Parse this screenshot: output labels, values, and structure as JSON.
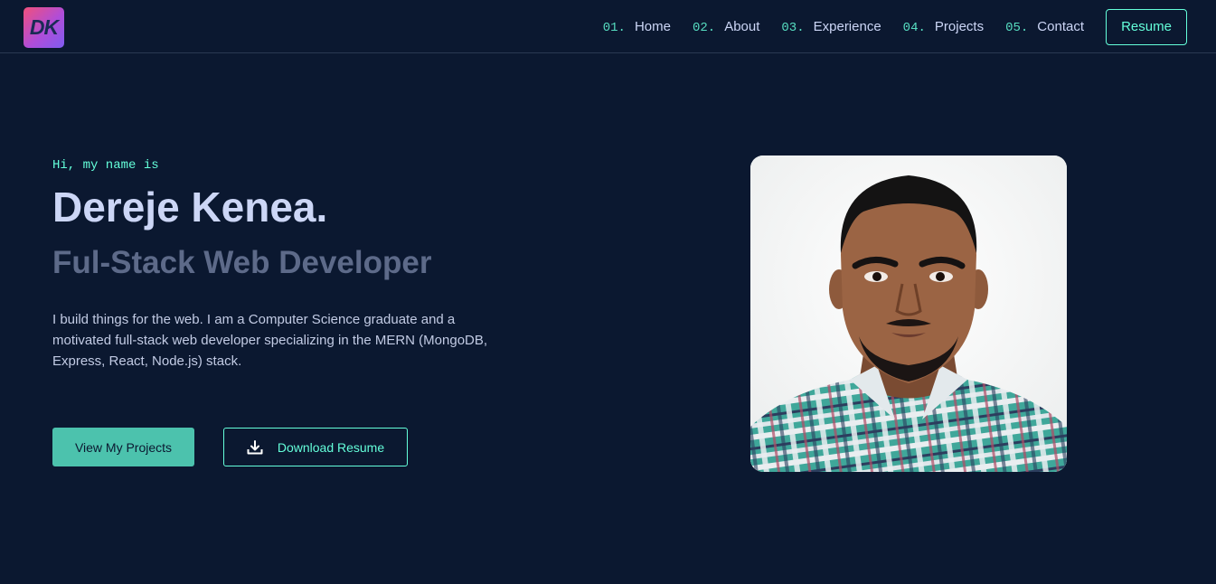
{
  "logo": {
    "text": "DK"
  },
  "nav": {
    "items": [
      {
        "num": "01.",
        "label": "Home"
      },
      {
        "num": "02.",
        "label": "About"
      },
      {
        "num": "03.",
        "label": "Experience"
      },
      {
        "num": "04.",
        "label": "Projects"
      },
      {
        "num": "05.",
        "label": "Contact"
      }
    ],
    "resume_label": "Resume"
  },
  "hero": {
    "greeting": "Hi, my name is",
    "name": "Dereje Kenea.",
    "role": "Ful-Stack Web Developer",
    "bio": "I build things for the web. I am a Computer Science graduate and a motivated full-stack web developer specializing in the MERN (MongoDB, Express, React, Node.js) stack.",
    "primary_button": "View My Projects",
    "secondary_button": "Download Resume",
    "secondary_icon": "download-icon",
    "photo_icon": "profile-photo"
  },
  "colors": {
    "background": "#0b1830",
    "accent": "#64ffda",
    "primary_button": "#4cc2ad",
    "heading": "#ccd6f6",
    "subheading": "#5d6a89"
  }
}
